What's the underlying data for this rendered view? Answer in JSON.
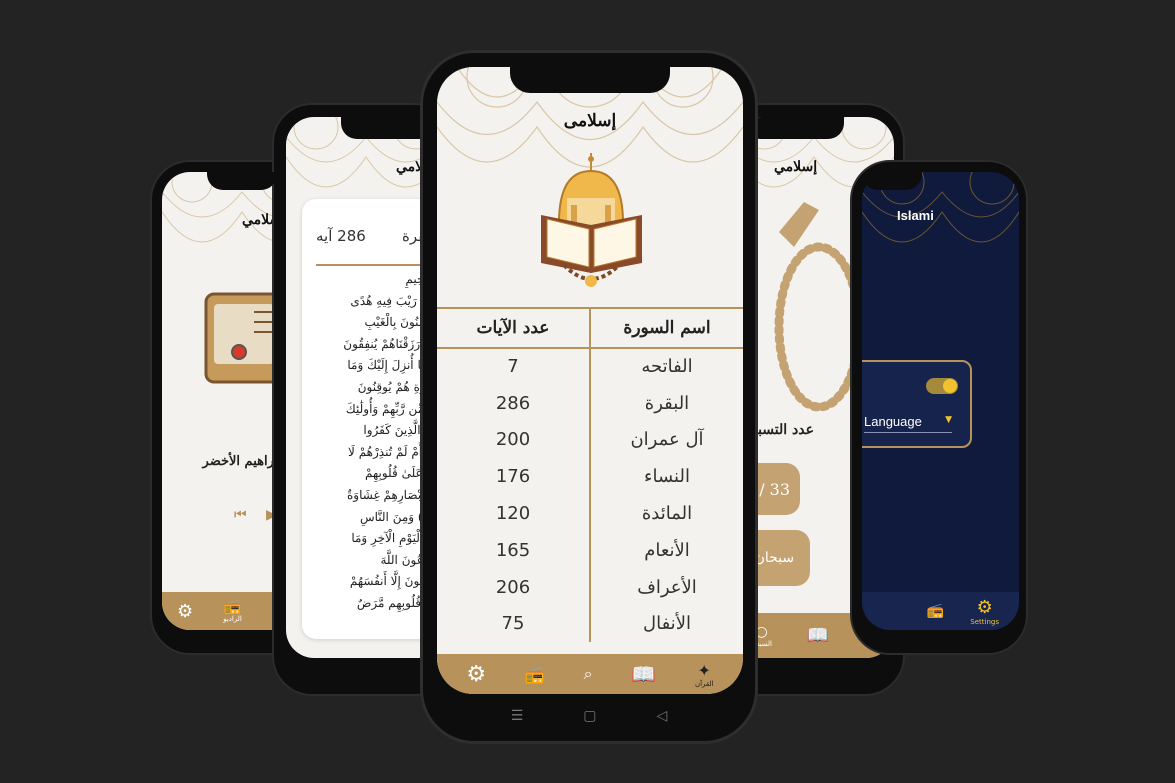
{
  "phone1": {
    "title": "إسلامي",
    "radio_name": "إبراهيم الأخضر",
    "nav_label": "الراديو"
  },
  "phone2": {
    "title": "إسلامي",
    "sura_name": "البقرة",
    "ayah_count": "286 آيه",
    "verses": [
      "بِسْمِ اللَّهِ الرَّحْمَٰنِ الرَّحِيمِ",
      "الم (1) ذَٰلِكَ الْكِتَابُ لَا رَيْبَ فِيهِ هُدًى",
      "لِلْمُتَّقِينَ (2) الَّذِينَ يُؤْمِنُونَ بِالْغَيْبِ",
      "وَيُقِيمُونَ الصَّلَاةَ وَمِمَّا رَزَقْنَاهُمْ يُنفِقُونَ",
      "(3) وَالَّذِينَ يُؤْمِنُونَ بِمَا أُنزِلَ إِلَيْكَ وَمَا",
      "أُنزِلَ مِن قَبْلِكَ وَبِالْآخِرَةِ هُمْ يُوقِنُونَ",
      "(4) أُولَٰئِكَ عَلَىٰ هُدًى مِّن رَّبِّهِمْ وَأُولَٰئِكَ",
      "هُمُ الْمُفْلِحُونَ (5) إِنَّ الَّذِينَ كَفَرُوا",
      "سَوَاءٌ عَلَيْهِمْ أَأَنذَرْتَهُمْ أَمْ لَمْ تُنذِرْهُمْ لَا",
      "يُؤْمِنُونَ (6) خَتَمَ اللَّهُ عَلَىٰ قُلُوبِهِمْ",
      "وَعَلَىٰ سَمْعِهِمْ وَعَلَىٰ أَبْصَارِهِمْ غِشَاوَةٌ",
      "وَلَهُمْ عَذَابٌ عَظِيمٌ (7) وَمِنَ النَّاسِ",
      "مَن يَقُولُ آمَنَّا بِاللَّهِ وَبِالْيَوْمِ الْآخِرِ وَمَا",
      "هُم بِمُؤْمِنِينَ (8) يُخَادِعُونَ اللَّهَ",
      "وَالَّذِينَ آمَنُوا وَمَا يَخْدَعُونَ إِلَّا أَنفُسَهُمْ",
      "وَمَا يَشْعُرُونَ (9) فِي قُلُوبِهِم مَّرَضٌ"
    ]
  },
  "phone3": {
    "title": "إسلامى",
    "table": {
      "col_name": "اسم السورة",
      "col_count": "عدد الآيات",
      "rows": [
        {
          "name": "الفاتحه",
          "count": "7"
        },
        {
          "name": "البقرة",
          "count": "286"
        },
        {
          "name": "آل عمران",
          "count": "200"
        },
        {
          "name": "النساء",
          "count": "176"
        },
        {
          "name": "المائدة",
          "count": "120"
        },
        {
          "name": "الأنعام",
          "count": "165"
        },
        {
          "name": "الأعراف",
          "count": "206"
        },
        {
          "name": "الأنفال",
          "count": "75"
        }
      ]
    },
    "nav": {
      "quran_label": "القرآن"
    }
  },
  "phone4": {
    "title": "إسلامي",
    "count_label": "عدد التسبيحات",
    "counter": "7 / 33",
    "tasbeeh": "سبحان الله",
    "nav_label": "السبحة"
  },
  "phone5": {
    "title": "Islami",
    "language_label": "Language",
    "nav_label": "Settings"
  },
  "colors": {
    "gold": "#b8925b",
    "background": "#232323",
    "dark_blue": "#101a3c",
    "yellow": "#f2c12e"
  }
}
